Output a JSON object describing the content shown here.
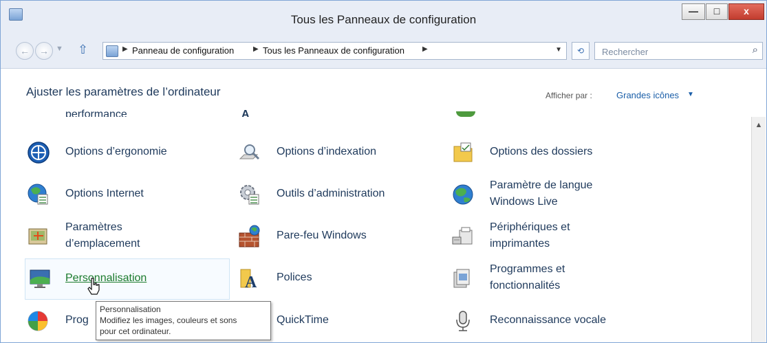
{
  "window": {
    "title": "Tous les Panneaux de configuration",
    "controls": {
      "minimize": "—",
      "maximize": "□",
      "close": "x"
    }
  },
  "addressbar": {
    "back_icon": "back-arrow-icon",
    "forward_icon": "forward-arrow-icon",
    "breadcrumbs": [
      "Panneau de configuration",
      "Tous les Panneaux de configuration"
    ],
    "search_placeholder": "Rechercher"
  },
  "header": {
    "title": "Ajuster les paramètres de l’ordinateur",
    "view_by_label": "Afficher par :",
    "view_by_value": "Grandes icônes"
  },
  "partial_row": [
    "performance",
    "A",
    ""
  ],
  "items": [
    {
      "label": "Options d’ergonomie",
      "icon": "ease-of-access-icon"
    },
    {
      "label": "Options d’indexation",
      "icon": "indexing-options-icon"
    },
    {
      "label": "Options des dossiers",
      "icon": "folder-options-icon"
    },
    {
      "label": "Options Internet",
      "icon": "internet-options-icon"
    },
    {
      "label": "Outils d’administration",
      "icon": "administrative-tools-icon"
    },
    {
      "label_lines": [
        "Paramètre de langue",
        "Windows Live"
      ],
      "icon": "windows-live-language-icon"
    },
    {
      "label_lines": [
        "Paramètres",
        "d’emplacement"
      ],
      "icon": "location-settings-icon"
    },
    {
      "label": "Pare-feu Windows",
      "icon": "firewall-icon"
    },
    {
      "label_lines": [
        "Périphériques et",
        "imprimantes"
      ],
      "icon": "devices-printers-icon"
    },
    {
      "label": "Personnalisation",
      "icon": "personalization-icon",
      "hovered": true
    },
    {
      "label": "Polices",
      "icon": "fonts-icon"
    },
    {
      "label_lines": [
        "Programmes et",
        "fonctionnalités"
      ],
      "icon": "programs-features-icon"
    },
    {
      "label": "Prog",
      "icon": "default-programs-icon"
    },
    {
      "label": "QuickTime",
      "icon": "quicktime-icon"
    },
    {
      "label": "Reconnaissance vocale",
      "icon": "speech-recognition-icon"
    }
  ],
  "tooltip": {
    "title": "Personnalisation",
    "lines": [
      "Modifiez les images, couleurs et sons",
      "pour cet ordinateur."
    ]
  },
  "colors": {
    "link_text": "#1e395b",
    "hover_text": "#1a7a2c",
    "accent": "#1a5ea8"
  }
}
